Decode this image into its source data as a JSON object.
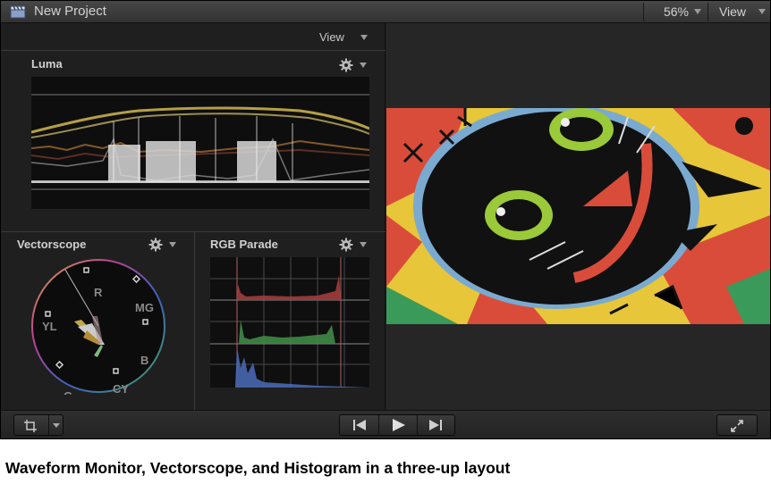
{
  "window": {
    "title": "New Project",
    "zoom": "56%",
    "view_label": "View"
  },
  "scopes_panel": {
    "view_label": "View",
    "luma": {
      "title": "Luma"
    },
    "vectorscope": {
      "title": "Vectorscope",
      "targets": [
        "R",
        "MG",
        "B",
        "CY",
        "G",
        "YL"
      ]
    },
    "rgb_parade": {
      "title": "RGB Parade"
    }
  },
  "toolbar": {
    "crop_tool": "crop-icon",
    "transport": [
      "go-to-start-icon",
      "play-icon",
      "go-to-end-icon"
    ],
    "fullscreen": "fullscreen-icon"
  },
  "caption": "Waveform Monitor, Vectorscope, and Histogram in a three-up layout",
  "colors": {
    "panel_bg": "#1f1f1f",
    "scope_bg": "#0e0e0e",
    "parade_red": "#c04a4a",
    "parade_green": "#4ea45a",
    "parade_blue": "#5a7ad0"
  }
}
